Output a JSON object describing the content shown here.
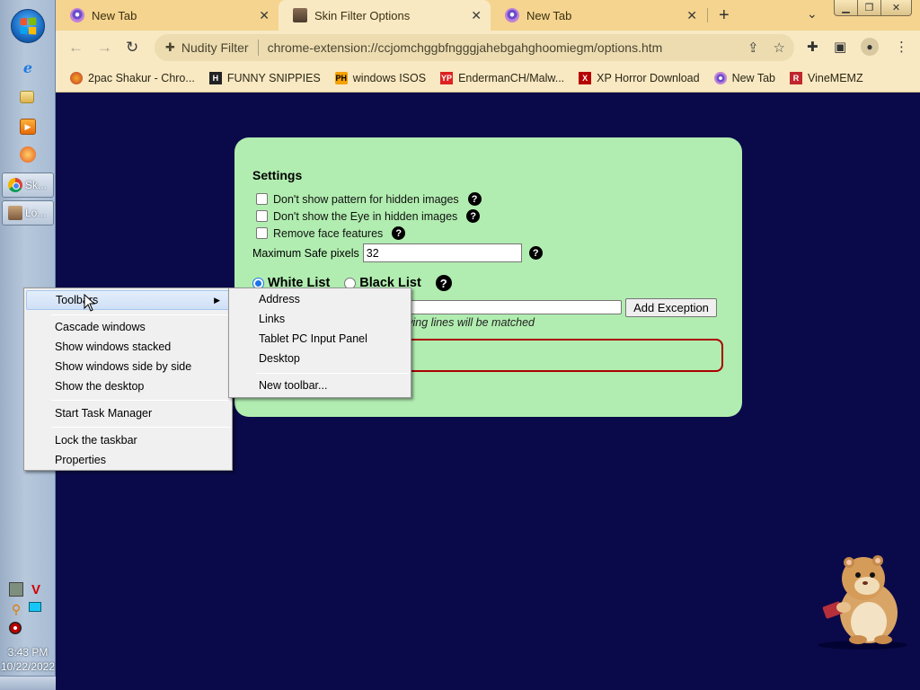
{
  "taskbar": {
    "start_icon": "windows-orb-icon",
    "pinned": [
      "internet-explorer-icon",
      "folder-icon",
      "media-player-icon",
      "app-icon"
    ],
    "tasks": [
      {
        "label": "Sk...",
        "icon": "chrome-icon"
      },
      {
        "label": "Lo...",
        "icon": "app-icon"
      }
    ],
    "clock": {
      "time": "3:43 PM",
      "date": "10/22/2022"
    }
  },
  "browser": {
    "tabs": [
      {
        "title": "New Tab",
        "active": false
      },
      {
        "title": "Skin Filter Options",
        "active": true
      },
      {
        "title": "New Tab",
        "active": false
      }
    ],
    "extension_chip": "Nudity Filter",
    "url": "chrome-extension://ccjomchggbfngggjahebgahghoomiegm/options.htm",
    "bookmarks": [
      {
        "label": "2pac Shakur - Chro...",
        "icon_text": ""
      },
      {
        "label": "FUNNY SNIPPIES",
        "icon_text": "H"
      },
      {
        "label": "windows ISOS",
        "icon_text": "PH"
      },
      {
        "label": "EndermanCH/Malw...",
        "icon_text": "YP"
      },
      {
        "label": "XP Horror Download",
        "icon_text": "X"
      },
      {
        "label": "New Tab",
        "icon_text": ""
      },
      {
        "label": "VineMEMZ",
        "icon_text": "R"
      }
    ],
    "colors": {
      "tabstrip": "#f4d48f",
      "toolbar": "#f8e9c3"
    }
  },
  "page": {
    "settings_title": "Settings",
    "options": [
      {
        "label": "Don't show pattern for hidden images",
        "checked": false
      },
      {
        "label": "Don't show the Eye in hidden images",
        "checked": false
      },
      {
        "label": "Remove face features",
        "checked": false
      }
    ],
    "max_safe_label": "Maximum Safe pixels",
    "max_safe_value": "32",
    "white_list_label": "White List",
    "black_list_label": "Black List",
    "selected_list": "White List",
    "add_exception_label": "Add Exception",
    "hint_text": "wing lines will be matched",
    "help_glyph": "?",
    "colors": {
      "card": "#b1edb0",
      "list_border": "#aa0000"
    }
  },
  "context_menu": {
    "items": [
      {
        "label": "Toolbars",
        "submenu": true
      },
      {
        "label": "Cascade windows"
      },
      {
        "label": "Show windows stacked"
      },
      {
        "label": "Show windows side by side"
      },
      {
        "label": "Show the desktop"
      },
      {
        "label": "Start Task Manager"
      },
      {
        "label": "Lock the taskbar"
      },
      {
        "label": "Properties"
      }
    ],
    "submenu": [
      {
        "label": "Address"
      },
      {
        "label": "Links"
      },
      {
        "label": "Tablet PC Input Panel"
      },
      {
        "label": "Desktop"
      },
      {
        "label": "New toolbar..."
      }
    ]
  },
  "desktop": {
    "background": "#0a0a4a"
  }
}
